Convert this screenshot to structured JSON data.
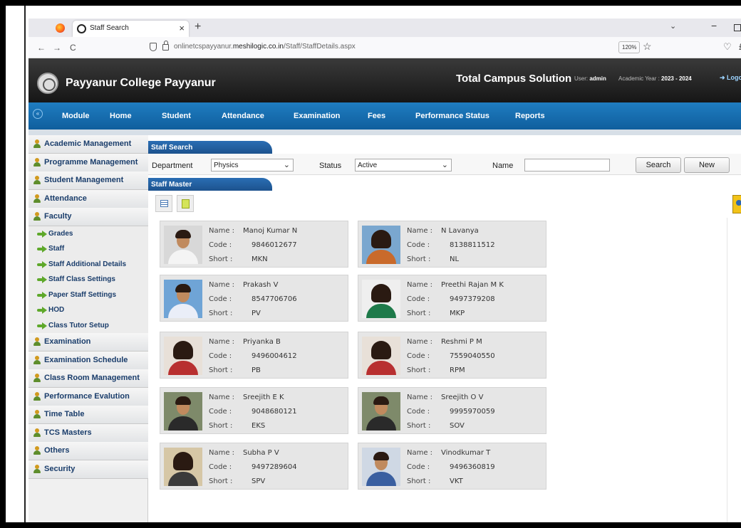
{
  "browser": {
    "tab_title": "Staff Search",
    "tab_close": "×",
    "new_tab": "+",
    "chevron": "⌄",
    "minimize": "−",
    "url_prefix": "onlinetcspayyanur.",
    "url_domain": "meshilogic.co.in",
    "url_path": "/Staff/StaffDetails.aspx",
    "zoom": "120%",
    "nav_back": "←",
    "nav_forward": "→",
    "nav_reload": "C",
    "star": "☆",
    "pocket": "♡",
    "ext": "£"
  },
  "header": {
    "college": "Payyanur College Payyanur",
    "product": "Total Campus Solution",
    "user_label": "User: ",
    "user_value": "admin",
    "year_label": "Academic Year : ",
    "year_value": "2023 - 2024",
    "logout": "➜ Logout"
  },
  "menu": {
    "circle": "«",
    "items": [
      "Module",
      "Home",
      "Student",
      "Attendance",
      "Examination",
      "Fees",
      "Performance Status",
      "Reports"
    ]
  },
  "sidebar": {
    "items": [
      {
        "label": "Academic Management",
        "type": "main"
      },
      {
        "label": "Programme Management",
        "type": "main"
      },
      {
        "label": "Student Management",
        "type": "main"
      },
      {
        "label": "Attendance",
        "type": "main"
      },
      {
        "label": "Faculty",
        "type": "main"
      },
      {
        "label": "Grades",
        "type": "sub"
      },
      {
        "label": "Staff",
        "type": "sub"
      },
      {
        "label": "Staff Additional Details",
        "type": "sub"
      },
      {
        "label": "Staff Class Settings",
        "type": "sub"
      },
      {
        "label": "Paper Staff Settings",
        "type": "sub"
      },
      {
        "label": "HOD",
        "type": "sub"
      },
      {
        "label": "Class Tutor Setup",
        "type": "sub"
      },
      {
        "label": "Examination",
        "type": "main"
      },
      {
        "label": "Examination Schedule",
        "type": "main"
      },
      {
        "label": "Class Room Management",
        "type": "main"
      },
      {
        "label": "Performance Evalution",
        "type": "main"
      },
      {
        "label": "Time Table",
        "type": "main"
      },
      {
        "label": "TCS Masters",
        "type": "main"
      },
      {
        "label": "Others",
        "type": "main"
      },
      {
        "label": "Security",
        "type": "main"
      }
    ]
  },
  "search": {
    "section_title": "Staff Search",
    "department_label": "Department",
    "department_value": "Physics",
    "status_label": "Status",
    "status_value": "Active",
    "name_label": "Name",
    "name_value": "",
    "search_button": "Search",
    "new_button": "New",
    "caret": "⌄"
  },
  "staff_master": {
    "section_title": "Staff Master",
    "key_name": "Name :",
    "key_code": "Code :",
    "key_short": "Short :",
    "staff": [
      {
        "name": "Manoj Kumar N",
        "code": "9846012677",
        "short": "MKN",
        "gender": "m"
      },
      {
        "name": "N Lavanya",
        "code": "8138811512",
        "short": "NL",
        "gender": "f"
      },
      {
        "name": "Prakash V",
        "code": "8547706706",
        "short": "PV",
        "gender": "m"
      },
      {
        "name": "Preethi Rajan M K",
        "code": "9497379208",
        "short": "MKP",
        "gender": "f"
      },
      {
        "name": "Priyanka B",
        "code": "9496004612",
        "short": "PB",
        "gender": "f"
      },
      {
        "name": "Reshmi P M",
        "code": "7559040550",
        "short": "RPM",
        "gender": "f"
      },
      {
        "name": "Sreejith E K",
        "code": "9048680121",
        "short": "EKS",
        "gender": "m"
      },
      {
        "name": "Sreejith O V",
        "code": "9995970059",
        "short": "SOV",
        "gender": "m"
      },
      {
        "name": "Subha P V",
        "code": "9497289604",
        "short": "SPV",
        "gender": "f"
      },
      {
        "name": "Vinodkumar T",
        "code": "9496360819",
        "short": "VKT",
        "gender": "m"
      }
    ]
  },
  "colors": {
    "menu_blue": "#1565a6",
    "sidebar_text": "#1a3d6b",
    "section_tab": "#2a6eb3",
    "card_bg": "#e6e6e6"
  }
}
